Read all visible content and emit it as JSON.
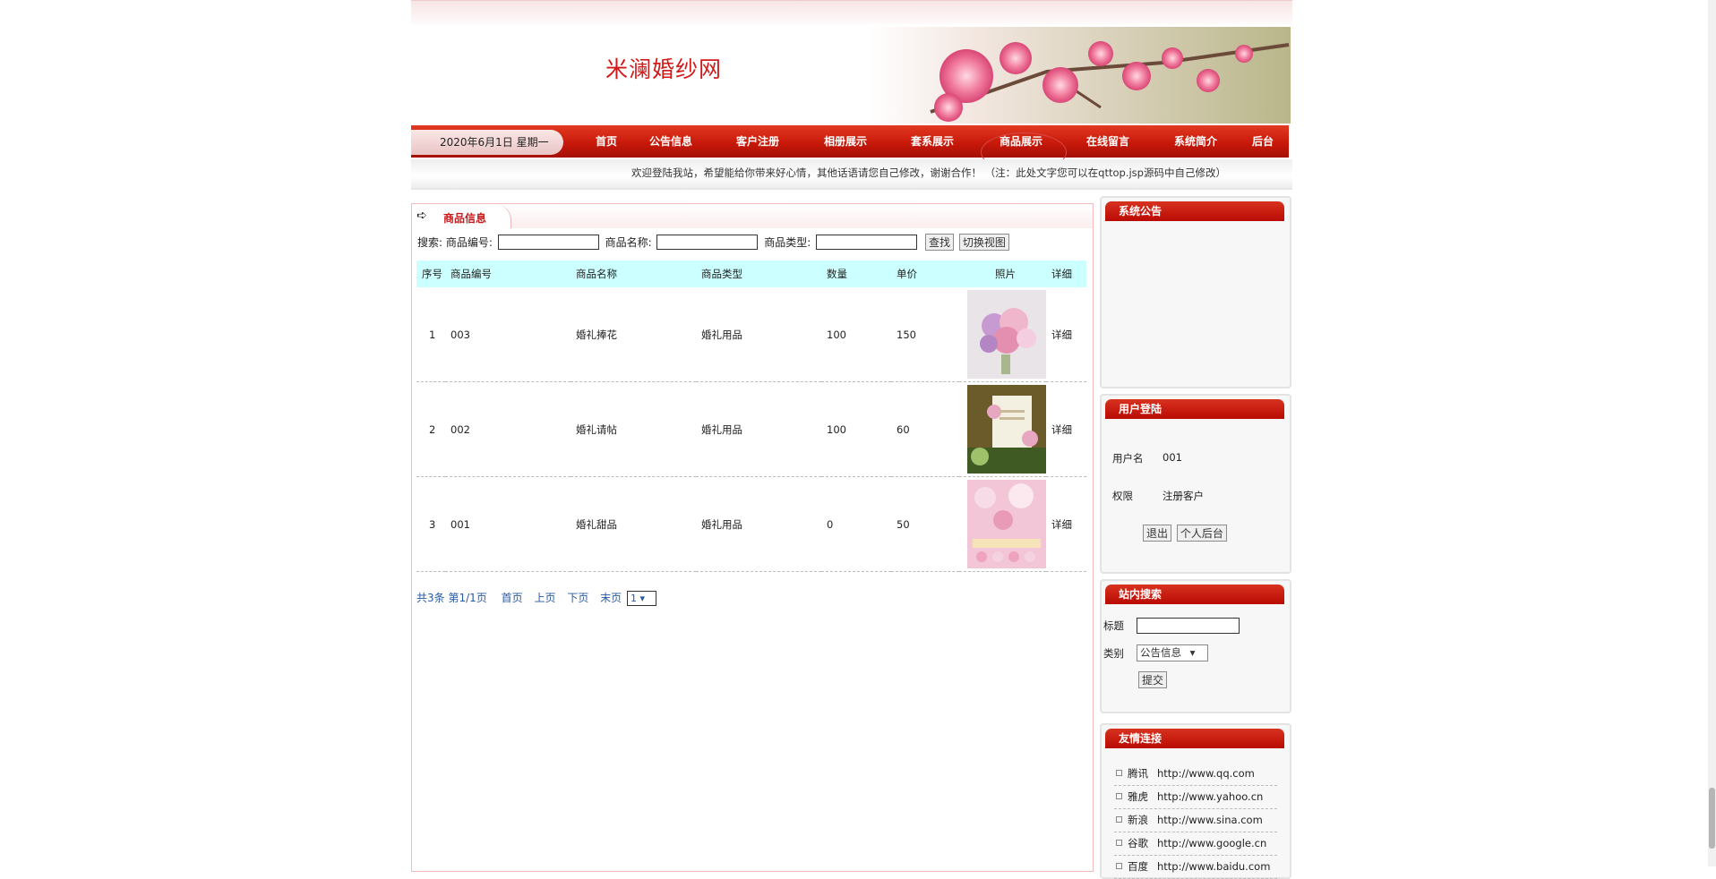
{
  "site": {
    "title": "米澜婚纱网"
  },
  "nav": {
    "date": "2020年6月1日 星期一",
    "items": [
      "首页",
      "公告信息",
      "客户注册",
      "相册展示",
      "套系展示",
      "商品展示",
      "在线留言",
      "系统简介",
      "后台"
    ]
  },
  "marquee": "欢迎登陆我站，希望能给你带来好心情，其他话语请您自己修改，谢谢合作！ （注：此处文字您可以在qttop.jsp源码中自己修改）",
  "main": {
    "tab": "商品信息",
    "search": {
      "prefix": "搜索:",
      "code_label": "商品编号:",
      "name_label": "商品名称:",
      "type_label": "商品类型:",
      "search_button": "查找",
      "switch_button": "切换视图"
    },
    "columns": [
      "序号",
      "商品编号",
      "商品名称",
      "商品类型",
      "数量",
      "单价",
      "照片",
      "详细"
    ],
    "rows": [
      {
        "no": "1",
        "code": "003",
        "name": "婚礼捧花",
        "type": "婚礼用品",
        "qty": "100",
        "price": "150",
        "detail": "详细",
        "photo": "bouquet-photo"
      },
      {
        "no": "2",
        "code": "002",
        "name": "婚礼请帖",
        "type": "婚礼用品",
        "qty": "100",
        "price": "60",
        "detail": "详细",
        "photo": "invitation-photo"
      },
      {
        "no": "3",
        "code": "001",
        "name": "婚礼甜品",
        "type": "婚礼用品",
        "qty": "0",
        "price": "50",
        "detail": "详细",
        "photo": "dessert-photo"
      }
    ],
    "pager": {
      "total": "共3条",
      "page": "第1/1页",
      "first": "首页",
      "prev": "上页",
      "next": "下页",
      "last": "末页",
      "select": "1"
    }
  },
  "sidebar": {
    "notice_title": "系统公告",
    "login": {
      "title": "用户登陆",
      "user_label": "用户名",
      "user_value": "001",
      "role_label": "权限",
      "role_value": "注册客户",
      "logout_button": "退出",
      "personal_button": "个人后台"
    },
    "search": {
      "title": "站内搜索",
      "title_label": "标题",
      "type_label": "类别",
      "type_value": "公告信息",
      "submit_button": "提交"
    },
    "links": {
      "title": "友情连接",
      "items": [
        {
          "name": "腾讯",
          "url": "http://www.qq.com"
        },
        {
          "name": "雅虎",
          "url": "http://www.yahoo.cn"
        },
        {
          "name": "新浪",
          "url": "http://www.sina.com"
        },
        {
          "name": "谷歌",
          "url": "http://www.google.cn"
        },
        {
          "name": "百度",
          "url": "http://www.baidu.com"
        }
      ]
    }
  },
  "colors": {
    "brand_red": "#c8191a",
    "nav_red": "#c8190a",
    "header_row": "#ccffff",
    "link_blue": "#2a5aa3"
  }
}
